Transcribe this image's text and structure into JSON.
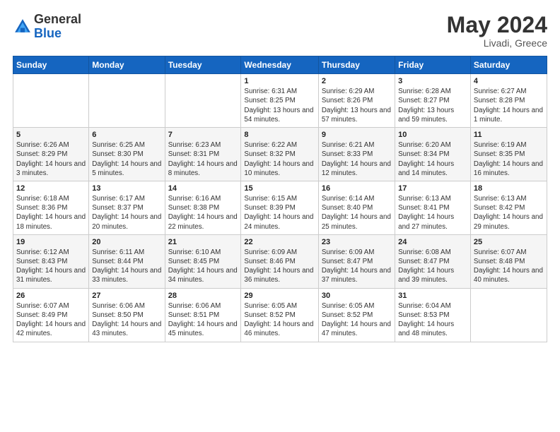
{
  "header": {
    "logo_general": "General",
    "logo_blue": "Blue",
    "title": "May 2024",
    "subtitle": "Livadi, Greece"
  },
  "weekdays": [
    "Sunday",
    "Monday",
    "Tuesday",
    "Wednesday",
    "Thursday",
    "Friday",
    "Saturday"
  ],
  "weeks": [
    [
      {
        "day": "",
        "sunrise": "",
        "sunset": "",
        "daylight": ""
      },
      {
        "day": "",
        "sunrise": "",
        "sunset": "",
        "daylight": ""
      },
      {
        "day": "",
        "sunrise": "",
        "sunset": "",
        "daylight": ""
      },
      {
        "day": "1",
        "sunrise": "Sunrise: 6:31 AM",
        "sunset": "Sunset: 8:25 PM",
        "daylight": "Daylight: 13 hours and 54 minutes."
      },
      {
        "day": "2",
        "sunrise": "Sunrise: 6:29 AM",
        "sunset": "Sunset: 8:26 PM",
        "daylight": "Daylight: 13 hours and 57 minutes."
      },
      {
        "day": "3",
        "sunrise": "Sunrise: 6:28 AM",
        "sunset": "Sunset: 8:27 PM",
        "daylight": "Daylight: 13 hours and 59 minutes."
      },
      {
        "day": "4",
        "sunrise": "Sunrise: 6:27 AM",
        "sunset": "Sunset: 8:28 PM",
        "daylight": "Daylight: 14 hours and 1 minute."
      }
    ],
    [
      {
        "day": "5",
        "sunrise": "Sunrise: 6:26 AM",
        "sunset": "Sunset: 8:29 PM",
        "daylight": "Daylight: 14 hours and 3 minutes."
      },
      {
        "day": "6",
        "sunrise": "Sunrise: 6:25 AM",
        "sunset": "Sunset: 8:30 PM",
        "daylight": "Daylight: 14 hours and 5 minutes."
      },
      {
        "day": "7",
        "sunrise": "Sunrise: 6:23 AM",
        "sunset": "Sunset: 8:31 PM",
        "daylight": "Daylight: 14 hours and 8 minutes."
      },
      {
        "day": "8",
        "sunrise": "Sunrise: 6:22 AM",
        "sunset": "Sunset: 8:32 PM",
        "daylight": "Daylight: 14 hours and 10 minutes."
      },
      {
        "day": "9",
        "sunrise": "Sunrise: 6:21 AM",
        "sunset": "Sunset: 8:33 PM",
        "daylight": "Daylight: 14 hours and 12 minutes."
      },
      {
        "day": "10",
        "sunrise": "Sunrise: 6:20 AM",
        "sunset": "Sunset: 8:34 PM",
        "daylight": "Daylight: 14 hours and 14 minutes."
      },
      {
        "day": "11",
        "sunrise": "Sunrise: 6:19 AM",
        "sunset": "Sunset: 8:35 PM",
        "daylight": "Daylight: 14 hours and 16 minutes."
      }
    ],
    [
      {
        "day": "12",
        "sunrise": "Sunrise: 6:18 AM",
        "sunset": "Sunset: 8:36 PM",
        "daylight": "Daylight: 14 hours and 18 minutes."
      },
      {
        "day": "13",
        "sunrise": "Sunrise: 6:17 AM",
        "sunset": "Sunset: 8:37 PM",
        "daylight": "Daylight: 14 hours and 20 minutes."
      },
      {
        "day": "14",
        "sunrise": "Sunrise: 6:16 AM",
        "sunset": "Sunset: 8:38 PM",
        "daylight": "Daylight: 14 hours and 22 minutes."
      },
      {
        "day": "15",
        "sunrise": "Sunrise: 6:15 AM",
        "sunset": "Sunset: 8:39 PM",
        "daylight": "Daylight: 14 hours and 24 minutes."
      },
      {
        "day": "16",
        "sunrise": "Sunrise: 6:14 AM",
        "sunset": "Sunset: 8:40 PM",
        "daylight": "Daylight: 14 hours and 25 minutes."
      },
      {
        "day": "17",
        "sunrise": "Sunrise: 6:13 AM",
        "sunset": "Sunset: 8:41 PM",
        "daylight": "Daylight: 14 hours and 27 minutes."
      },
      {
        "day": "18",
        "sunrise": "Sunrise: 6:13 AM",
        "sunset": "Sunset: 8:42 PM",
        "daylight": "Daylight: 14 hours and 29 minutes."
      }
    ],
    [
      {
        "day": "19",
        "sunrise": "Sunrise: 6:12 AM",
        "sunset": "Sunset: 8:43 PM",
        "daylight": "Daylight: 14 hours and 31 minutes."
      },
      {
        "day": "20",
        "sunrise": "Sunrise: 6:11 AM",
        "sunset": "Sunset: 8:44 PM",
        "daylight": "Daylight: 14 hours and 33 minutes."
      },
      {
        "day": "21",
        "sunrise": "Sunrise: 6:10 AM",
        "sunset": "Sunset: 8:45 PM",
        "daylight": "Daylight: 14 hours and 34 minutes."
      },
      {
        "day": "22",
        "sunrise": "Sunrise: 6:09 AM",
        "sunset": "Sunset: 8:46 PM",
        "daylight": "Daylight: 14 hours and 36 minutes."
      },
      {
        "day": "23",
        "sunrise": "Sunrise: 6:09 AM",
        "sunset": "Sunset: 8:47 PM",
        "daylight": "Daylight: 14 hours and 37 minutes."
      },
      {
        "day": "24",
        "sunrise": "Sunrise: 6:08 AM",
        "sunset": "Sunset: 8:47 PM",
        "daylight": "Daylight: 14 hours and 39 minutes."
      },
      {
        "day": "25",
        "sunrise": "Sunrise: 6:07 AM",
        "sunset": "Sunset: 8:48 PM",
        "daylight": "Daylight: 14 hours and 40 minutes."
      }
    ],
    [
      {
        "day": "26",
        "sunrise": "Sunrise: 6:07 AM",
        "sunset": "Sunset: 8:49 PM",
        "daylight": "Daylight: 14 hours and 42 minutes."
      },
      {
        "day": "27",
        "sunrise": "Sunrise: 6:06 AM",
        "sunset": "Sunset: 8:50 PM",
        "daylight": "Daylight: 14 hours and 43 minutes."
      },
      {
        "day": "28",
        "sunrise": "Sunrise: 6:06 AM",
        "sunset": "Sunset: 8:51 PM",
        "daylight": "Daylight: 14 hours and 45 minutes."
      },
      {
        "day": "29",
        "sunrise": "Sunrise: 6:05 AM",
        "sunset": "Sunset: 8:52 PM",
        "daylight": "Daylight: 14 hours and 46 minutes."
      },
      {
        "day": "30",
        "sunrise": "Sunrise: 6:05 AM",
        "sunset": "Sunset: 8:52 PM",
        "daylight": "Daylight: 14 hours and 47 minutes."
      },
      {
        "day": "31",
        "sunrise": "Sunrise: 6:04 AM",
        "sunset": "Sunset: 8:53 PM",
        "daylight": "Daylight: 14 hours and 48 minutes."
      },
      {
        "day": "",
        "sunrise": "",
        "sunset": "",
        "daylight": ""
      }
    ]
  ]
}
